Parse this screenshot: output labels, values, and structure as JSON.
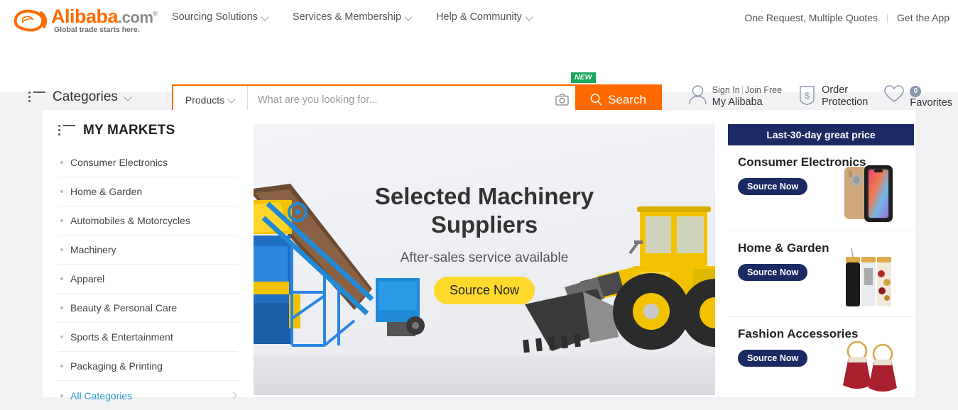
{
  "header": {
    "logo": {
      "name": "Alibaba",
      "domain": ".com",
      "tagline": "Global trade starts here."
    },
    "nav": [
      {
        "label": "Sourcing Solutions",
        "icon": "chevron-down-icon"
      },
      {
        "label": "Services & Membership",
        "icon": "chevron-down-icon"
      },
      {
        "label": "Help & Community",
        "icon": "chevron-down-icon"
      }
    ],
    "top_links": [
      {
        "label": "One Request, Multiple Quotes"
      },
      {
        "label": "Get the App"
      }
    ],
    "categories_label": "Categories",
    "search": {
      "scope": "Products",
      "placeholder": "What are you looking for...",
      "value": "",
      "button_label": "Search",
      "new_badge": "NEW",
      "camera_icon": "camera-icon",
      "search_icon": "magnifier-icon"
    },
    "user_tools": {
      "sign_in": "Sign In",
      "separator": "|",
      "join_free": "Join Free",
      "my_alibaba": "My Alibaba",
      "order_line1": "Order",
      "order_line2": "Protection",
      "favorites_label": "Favorites",
      "favorites_count": "0"
    }
  },
  "sidebar": {
    "title": "MY MARKETS",
    "items": [
      {
        "label": "Consumer Electronics"
      },
      {
        "label": "Home & Garden"
      },
      {
        "label": "Automobiles & Motorcycles"
      },
      {
        "label": "Machinery"
      },
      {
        "label": "Apparel"
      },
      {
        "label": "Beauty & Personal Care"
      },
      {
        "label": "Sports & Entertainment"
      },
      {
        "label": "Packaging & Printing"
      },
      {
        "label": "All Categories"
      }
    ]
  },
  "hero": {
    "title": "Selected Machinery Suppliers",
    "subtitle": "After-sales service available",
    "cta": "Source Now"
  },
  "promo": {
    "header": "Last-30-day great price",
    "cards": [
      {
        "title": "Consumer Electronics",
        "cta": "Source Now",
        "image": "smartphone-product-image"
      },
      {
        "title": "Home & Garden",
        "cta": "Source Now",
        "image": "water-bottles-product-image"
      },
      {
        "title": "Fashion Accessories",
        "cta": "Source Now",
        "image": "tassel-earrings-product-image"
      }
    ]
  },
  "colors": {
    "brand_orange": "#ff6a00",
    "promo_navy": "#1b2a63",
    "cta_yellow": "#ffd92b",
    "badge_green": "#19a85b",
    "link_blue": "#2e9ad0",
    "page_bg": "#f2f2f5"
  }
}
